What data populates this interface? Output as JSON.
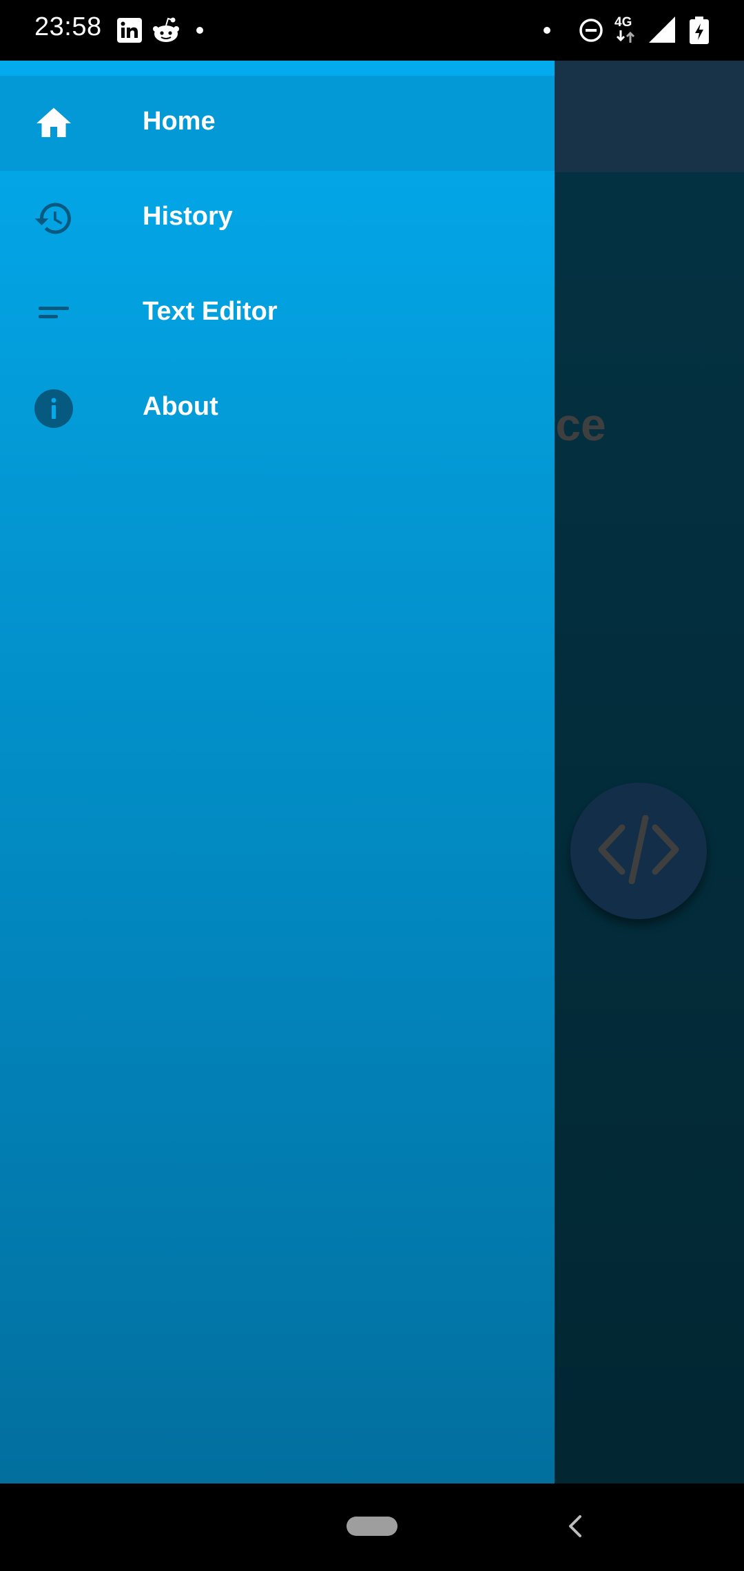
{
  "status_bar": {
    "time": "23:58",
    "notification_icons": [
      "linkedin-icon",
      "reddit-icon",
      "dot-icon"
    ],
    "system_icons": [
      "dot-icon",
      "do-not-disturb-icon",
      "network-4g-icon",
      "signal-icon",
      "battery-charging-icon"
    ],
    "network_label": "4G"
  },
  "drawer": {
    "items": [
      {
        "label": "Home",
        "icon": "home-icon",
        "selected": true
      },
      {
        "label": "History",
        "icon": "history-icon",
        "selected": false
      },
      {
        "label": "Text Editor",
        "icon": "text-lines-icon",
        "selected": false
      },
      {
        "label": "About",
        "icon": "info-icon",
        "selected": false
      }
    ]
  },
  "background_app": {
    "heading_partial": "ource",
    "fab_icon": "code-icon"
  },
  "nav_bar": {
    "buttons": [
      "home-pill",
      "back-icon"
    ]
  },
  "colors": {
    "drawer_top": "#03aaed",
    "drawer_bottom": "#026f9e",
    "selected_item": "#0398d6",
    "icon_dark": "#065a80",
    "label_text": "#ffffff"
  }
}
